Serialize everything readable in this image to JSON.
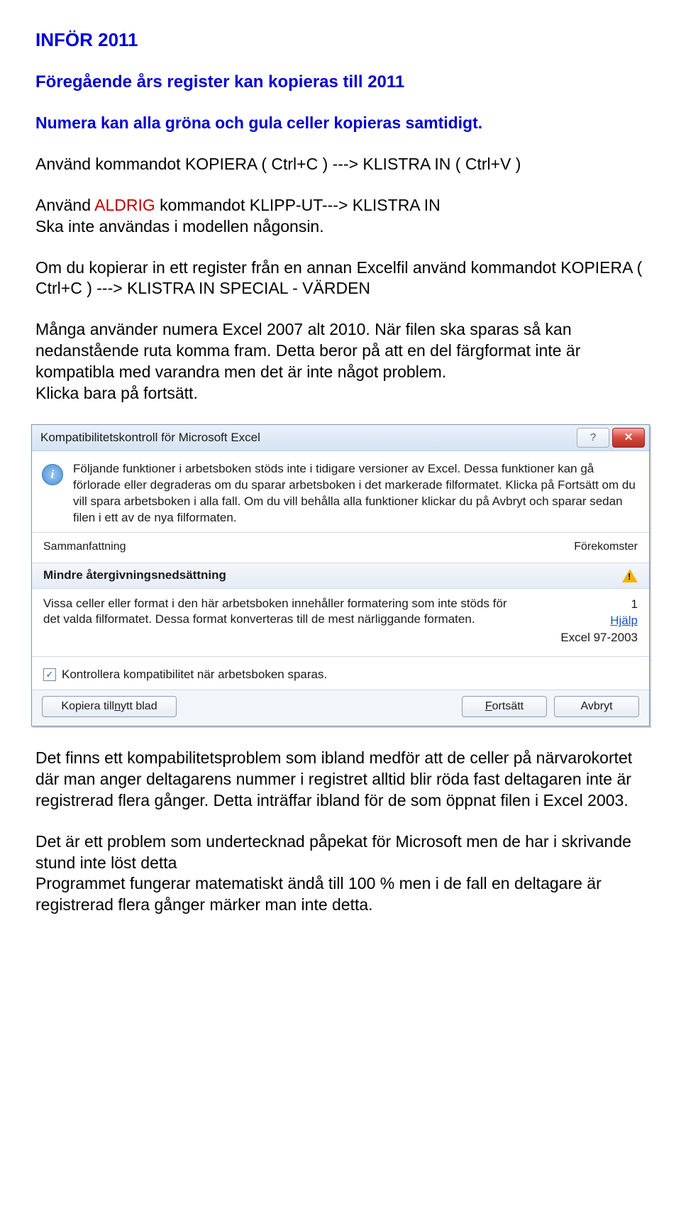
{
  "title": "INFÖR 2011",
  "line1": "Föregående års register kan kopieras till 2011",
  "line2": "Numera kan alla gröna och gula celler kopieras samtidigt.",
  "cmd1_prefix": "Använd kommandot KOPIERA ( Ctrl+C ) ---> KLISTRA IN ( Ctrl+V )",
  "cmd2_a": "Använd ",
  "cmd2_red": "ALDRIG",
  "cmd2_b": " kommandot KLIPP-UT---> KLISTRA IN",
  "cmd2_c": "Ska inte användas i modellen någonsin.",
  "para3": "Om du kopierar in ett register från en annan Excelfil använd kommandot KOPIERA ( Ctrl+C ) ---> KLISTRA IN SPECIAL - VÄRDEN",
  "para4": "Många använder numera Excel 2007 alt 2010. När filen ska sparas så kan nedanstående ruta komma fram. Detta beror på att en del färgformat inte är kompatibla med varandra men det är inte något problem.",
  "para4b": "Klicka bara på fortsätt.",
  "dialog": {
    "title": "Kompatibilitetskontroll för Microsoft Excel",
    "help_glyph": "?",
    "close_glyph": "✕",
    "info_glyph": "i",
    "body": "Följande funktioner i arbetsboken stöds inte i tidigare versioner av Excel. Dessa funktioner kan gå förlorade eller degraderas om du sparar arbetsboken i det markerade filformatet. Klicka på Fortsätt om du vill spara arbetsboken i alla fall. Om du vill behålla alla funktioner klickar du på Avbryt och sparar sedan filen i ett av de nya filformaten.",
    "summary_left": "Sammanfattning",
    "summary_right": "Förekomster",
    "sub_header": "Mindre återgivningsnedsättning",
    "detail_left": "Vissa celler eller format i den här arbetsboken innehåller formatering som inte stöds för det valda filformatet. Dessa format konverteras till de mest närliggande formaten.",
    "detail_count": "1",
    "detail_link": "Hjälp",
    "detail_ver": "Excel 97-2003",
    "checkbox_label": "Kontrollera kompatibilitet när arbetsboken sparas.",
    "check_glyph": "✓",
    "btn_copy_a": "Kopiera till ",
    "btn_copy_u": "n",
    "btn_copy_b": "ytt blad",
    "btn_cont_u": "F",
    "btn_cont_b": "ortsätt",
    "btn_cancel": "Avbryt"
  },
  "after1": "Det finns ett kompabilitetsproblem som ibland medför att de celler på närvarokortet där man anger deltagarens nummer i registret alltid blir röda fast deltagaren inte är  registrerad flera gånger. Detta inträffar ibland för de som öppnat filen i Excel 2003.",
  "after2a": "Det är ett problem som undertecknad påpekat för Microsoft men de har i skrivande stund inte löst detta",
  "after2b": "Programmet fungerar matematiskt ändå till 100 % men i de fall en deltagare är registrerad flera gånger märker man inte detta."
}
